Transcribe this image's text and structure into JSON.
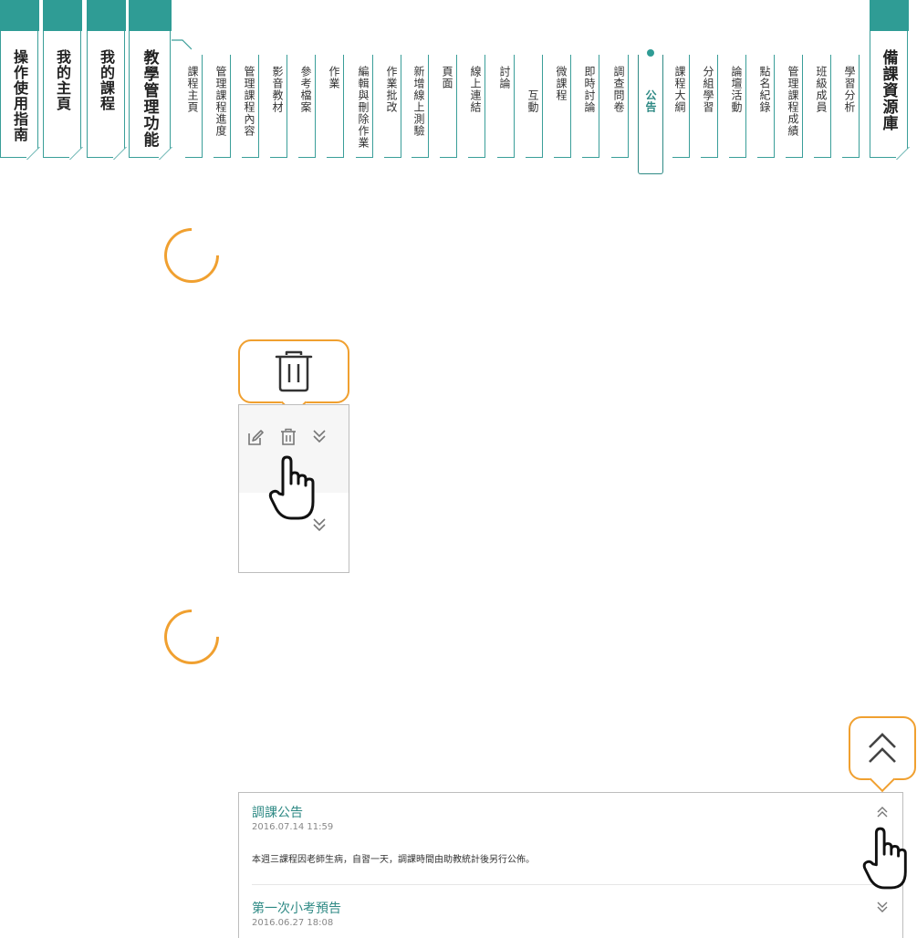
{
  "nav": {
    "main_tabs": [
      {
        "label": "操作使用指南"
      },
      {
        "label": "我的主頁"
      },
      {
        "label": "我的課程"
      },
      {
        "label": "教學管理功能"
      },
      {
        "label": "備課資源庫"
      }
    ],
    "sub_items": [
      {
        "label": "課程主頁"
      },
      {
        "label": "管理課程進度"
      },
      {
        "label": "管理課程內容"
      },
      {
        "label": "影音教材"
      },
      {
        "label": "參考檔案"
      },
      {
        "label": "作業"
      },
      {
        "label": "編輯與刪除作業"
      },
      {
        "label": "作業批改"
      },
      {
        "label": "新增線上測驗"
      },
      {
        "label": "頁面"
      },
      {
        "label": "線上連結"
      },
      {
        "label": "討論"
      },
      {
        "label": "互動"
      },
      {
        "label": "微課程"
      },
      {
        "label": "即時討論"
      },
      {
        "label": "調查問卷"
      },
      {
        "label": "公告",
        "active": true
      },
      {
        "label": "課程大綱"
      },
      {
        "label": "分組學習"
      },
      {
        "label": "論壇活動"
      },
      {
        "label": "點名紀錄"
      },
      {
        "label": "管理課程成績"
      },
      {
        "label": "班級成員"
      },
      {
        "label": "學習分析"
      }
    ]
  },
  "colors": {
    "teal": "#2f9c95",
    "orange": "#f0a030",
    "title_teal": "#2f8a85"
  },
  "icons": {
    "delete_callout": "trash-icon",
    "collapse_callout": "double-chevron-up-icon",
    "pointer": "hand-pointer-icon"
  },
  "announcements": [
    {
      "title": "調課公告",
      "date": "2016.07.14 11:59",
      "body": "本週三課程因老師生病，自習一天，調課時間由助教統計後另行公佈。",
      "expanded": true
    },
    {
      "title": "第一次小考預告",
      "date": "2016.06.27 18:08",
      "expanded": false
    }
  ]
}
